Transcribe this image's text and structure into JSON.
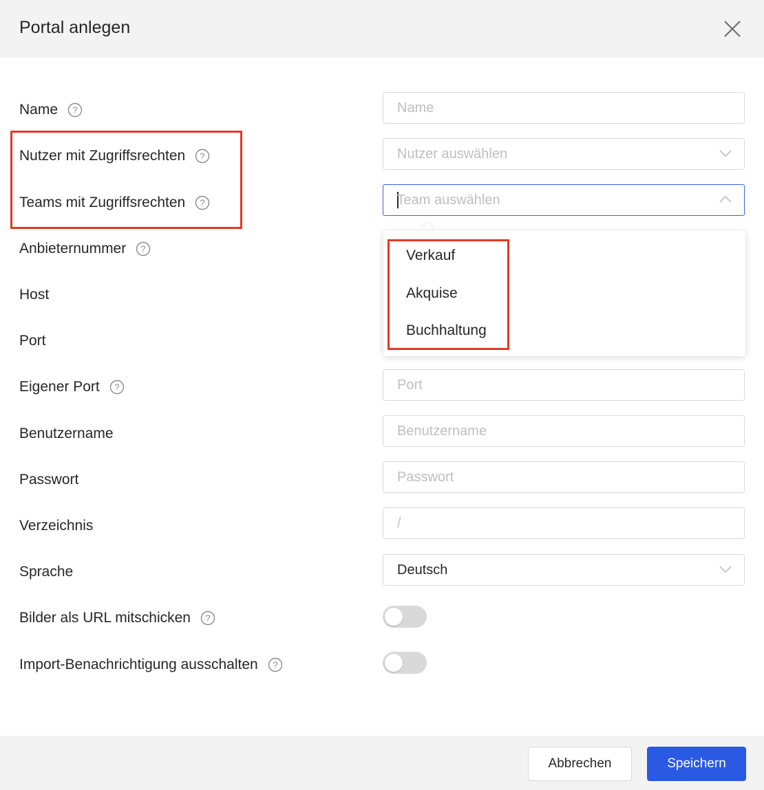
{
  "dialog": {
    "title": "Portal anlegen",
    "close_icon": "close-icon"
  },
  "fields": {
    "name": {
      "label": "Name",
      "placeholder": "Name"
    },
    "users": {
      "label": "Nutzer mit Zugriffsrechten",
      "placeholder": "Nutzer auswählen"
    },
    "teams": {
      "label": "Teams mit Zugriffsrechten",
      "placeholder": "Team auswählen"
    },
    "provider_number": {
      "label": "Anbieternummer"
    },
    "host": {
      "label": "Host"
    },
    "port": {
      "label": "Port"
    },
    "custom_port": {
      "label": "Eigener Port",
      "placeholder": "Port"
    },
    "username": {
      "label": "Benutzername",
      "placeholder": "Benutzername"
    },
    "password": {
      "label": "Passwort",
      "placeholder": "Passwort"
    },
    "directory": {
      "label": "Verzeichnis",
      "placeholder": "/"
    },
    "language": {
      "label": "Sprache",
      "value": "Deutsch"
    },
    "images_as_url": {
      "label": "Bilder als URL mitschicken",
      "enabled": false
    },
    "disable_import_notification": {
      "label": "Import-Benachrichtigung ausschalten",
      "enabled": false
    }
  },
  "team_dropdown": {
    "options": [
      "Verkauf",
      "Akquise",
      "Buchhaltung"
    ]
  },
  "footer": {
    "cancel_label": "Abbrechen",
    "save_label": "Speichern"
  },
  "colors": {
    "primary": "#2a59e3",
    "highlight": "#e03a22",
    "header_bg": "#f3f3f3",
    "focus_border": "#3560dd"
  }
}
